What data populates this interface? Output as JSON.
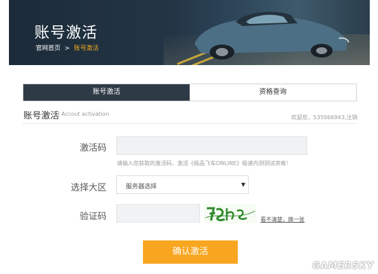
{
  "banner": {
    "title": "账号激活",
    "breadcrumb_home": "官网首页",
    "breadcrumb_sep": ">",
    "breadcrumb_current": "账号激活"
  },
  "tabs": [
    {
      "label": "账号激活",
      "active": true
    },
    {
      "label": "资格查询",
      "active": false
    }
  ],
  "section": {
    "title": "账号激活",
    "subtitle": "/ Accout activation",
    "user_info": "欢迎您，535066943,注销"
  },
  "form": {
    "code_label": "激活码",
    "code_value": "",
    "code_hint": "请输入您获取的激活码，激活《极品飞车ONLINE》极速内测测试资格！",
    "region_label": "选择大区",
    "region_selected": "服务器选择",
    "captcha_label": "验证码",
    "captcha_value": "",
    "captcha_refresh": "看不清楚，换一张",
    "submit_label": "确认激活"
  },
  "watermark": "GAMERSKY",
  "colors": {
    "banner_bg": "#233545",
    "tab_active": "#2f3a47",
    "accent_orange": "#f8a620",
    "breadcrumb_active": "#f0a81e"
  }
}
